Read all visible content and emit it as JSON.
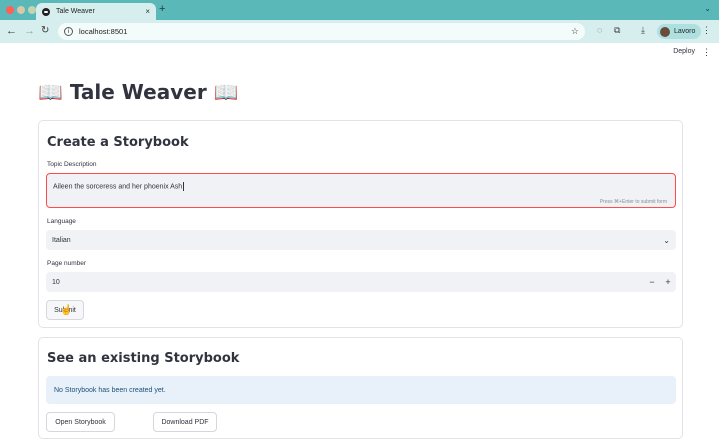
{
  "browser": {
    "tab_title": "Tale Weaver",
    "tab_close": "×",
    "new_tab": "+",
    "url": "localhost:8501",
    "profile_name": "Lavoro"
  },
  "app_header": {
    "deploy_label": "Deploy",
    "menu_glyph": "⋮"
  },
  "page": {
    "title": "📖 Tale Weaver 📖"
  },
  "create_section": {
    "heading": "Create a Storybook",
    "topic_label": "Topic Description",
    "topic_value": "Aileen the sorceress and her phoenix Ash",
    "topic_hint": "Press ⌘+Enter to submit form",
    "language_label": "Language",
    "language_value": "Italian",
    "page_number_label": "Page number",
    "page_number_value": "10",
    "decrement": "−",
    "increment": "+",
    "submit_label": "Submit"
  },
  "existing_section": {
    "heading": "See an existing Storybook",
    "info_message": "No Storybook has been created yet.",
    "open_label": "Open Storybook",
    "download_label": "Download PDF"
  },
  "colors": {
    "tab_strip": "#5bb8b8",
    "toolbar": "#d6eeee",
    "input_bg": "#f0f2f6",
    "error_border": "#ff4b4b",
    "info_bg": "#e8f1fa",
    "info_text": "#1d4f7a",
    "text": "#31333f"
  }
}
